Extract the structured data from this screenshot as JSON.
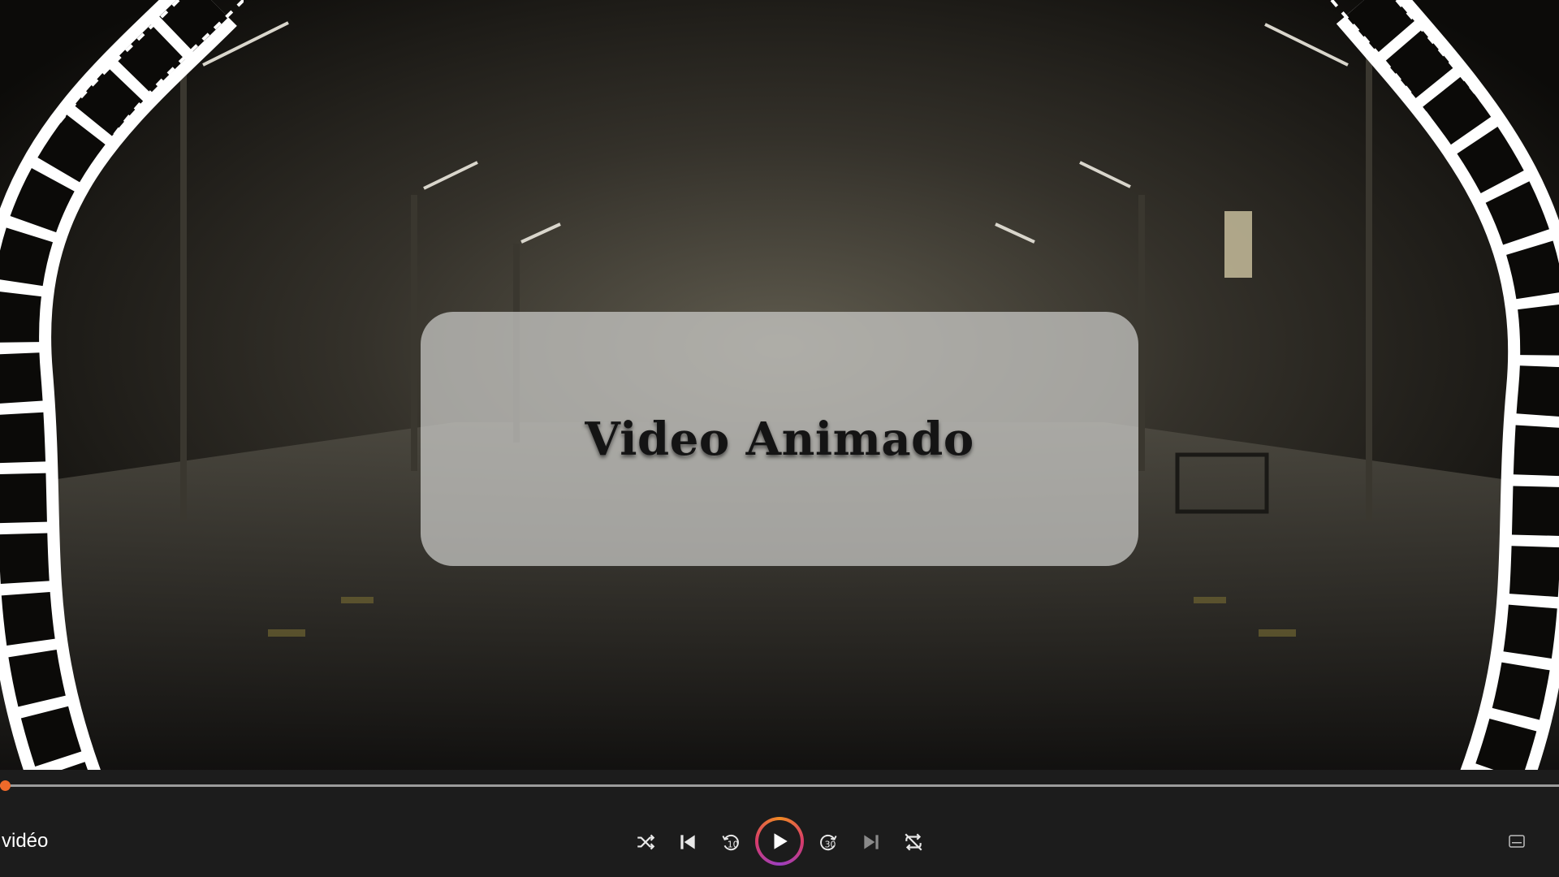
{
  "title_card": {
    "text": "Video Animado"
  },
  "player": {
    "media_title": "vidéo",
    "progress": 0.0,
    "accent_color": "#ef6a2a",
    "controls": [
      {
        "name": "shuffle",
        "icon": "shuffle-icon"
      },
      {
        "name": "previous",
        "icon": "skip-previous-icon"
      },
      {
        "name": "rewind",
        "icon": "rewind-icon",
        "label": "10"
      },
      {
        "name": "play",
        "icon": "play-icon"
      },
      {
        "name": "forward",
        "icon": "fast-forward-icon",
        "label": "30"
      },
      {
        "name": "next",
        "icon": "skip-next-icon"
      },
      {
        "name": "repeat",
        "icon": "repeat-off-icon"
      }
    ]
  },
  "background": {
    "description_colors": [
      "#2b2820",
      "#0d0c0a"
    ]
  }
}
